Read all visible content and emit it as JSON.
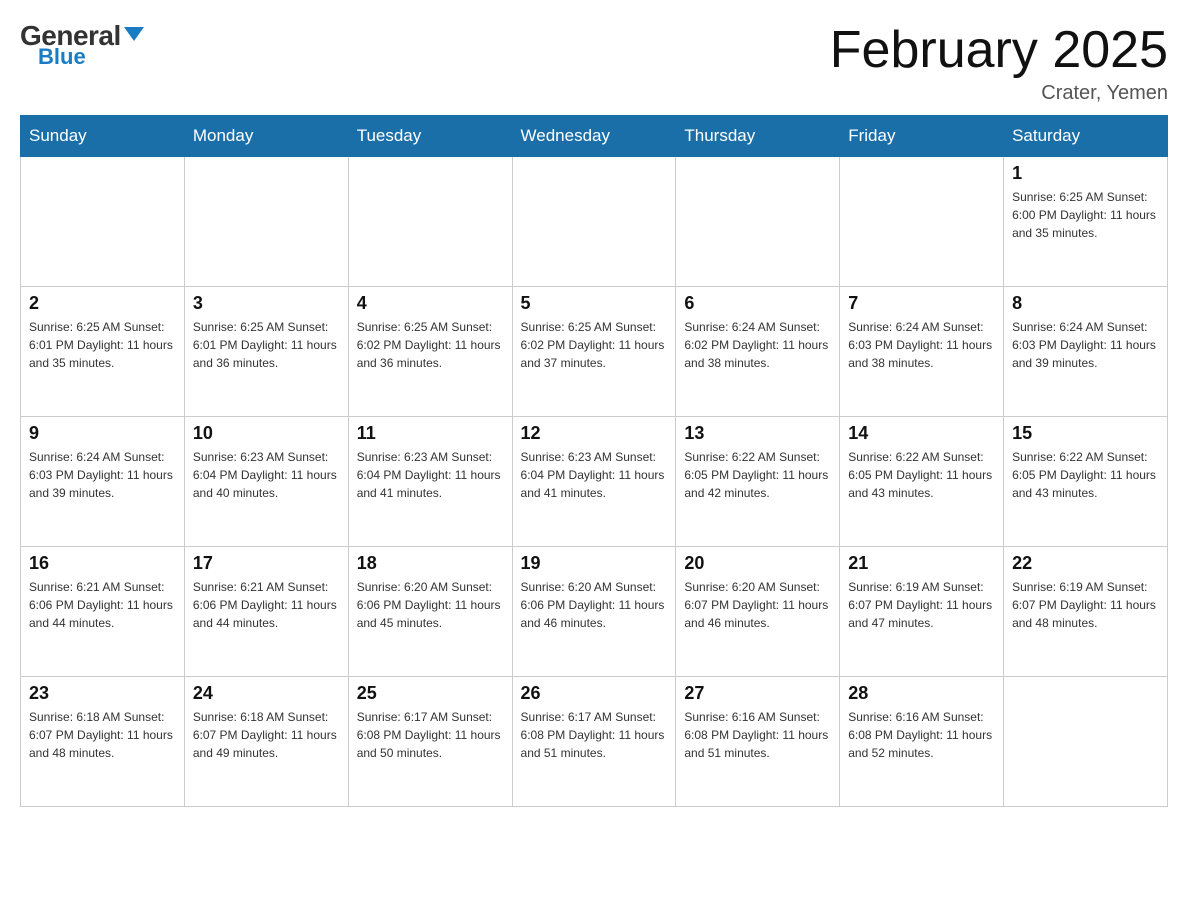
{
  "header": {
    "logo_general": "General",
    "logo_blue": "Blue",
    "month_title": "February 2025",
    "location": "Crater, Yemen"
  },
  "weekdays": [
    "Sunday",
    "Monday",
    "Tuesday",
    "Wednesday",
    "Thursday",
    "Friday",
    "Saturday"
  ],
  "weeks": [
    [
      {
        "day": "",
        "info": ""
      },
      {
        "day": "",
        "info": ""
      },
      {
        "day": "",
        "info": ""
      },
      {
        "day": "",
        "info": ""
      },
      {
        "day": "",
        "info": ""
      },
      {
        "day": "",
        "info": ""
      },
      {
        "day": "1",
        "info": "Sunrise: 6:25 AM\nSunset: 6:00 PM\nDaylight: 11 hours\nand 35 minutes."
      }
    ],
    [
      {
        "day": "2",
        "info": "Sunrise: 6:25 AM\nSunset: 6:01 PM\nDaylight: 11 hours\nand 35 minutes."
      },
      {
        "day": "3",
        "info": "Sunrise: 6:25 AM\nSunset: 6:01 PM\nDaylight: 11 hours\nand 36 minutes."
      },
      {
        "day": "4",
        "info": "Sunrise: 6:25 AM\nSunset: 6:02 PM\nDaylight: 11 hours\nand 36 minutes."
      },
      {
        "day": "5",
        "info": "Sunrise: 6:25 AM\nSunset: 6:02 PM\nDaylight: 11 hours\nand 37 minutes."
      },
      {
        "day": "6",
        "info": "Sunrise: 6:24 AM\nSunset: 6:02 PM\nDaylight: 11 hours\nand 38 minutes."
      },
      {
        "day": "7",
        "info": "Sunrise: 6:24 AM\nSunset: 6:03 PM\nDaylight: 11 hours\nand 38 minutes."
      },
      {
        "day": "8",
        "info": "Sunrise: 6:24 AM\nSunset: 6:03 PM\nDaylight: 11 hours\nand 39 minutes."
      }
    ],
    [
      {
        "day": "9",
        "info": "Sunrise: 6:24 AM\nSunset: 6:03 PM\nDaylight: 11 hours\nand 39 minutes."
      },
      {
        "day": "10",
        "info": "Sunrise: 6:23 AM\nSunset: 6:04 PM\nDaylight: 11 hours\nand 40 minutes."
      },
      {
        "day": "11",
        "info": "Sunrise: 6:23 AM\nSunset: 6:04 PM\nDaylight: 11 hours\nand 41 minutes."
      },
      {
        "day": "12",
        "info": "Sunrise: 6:23 AM\nSunset: 6:04 PM\nDaylight: 11 hours\nand 41 minutes."
      },
      {
        "day": "13",
        "info": "Sunrise: 6:22 AM\nSunset: 6:05 PM\nDaylight: 11 hours\nand 42 minutes."
      },
      {
        "day": "14",
        "info": "Sunrise: 6:22 AM\nSunset: 6:05 PM\nDaylight: 11 hours\nand 43 minutes."
      },
      {
        "day": "15",
        "info": "Sunrise: 6:22 AM\nSunset: 6:05 PM\nDaylight: 11 hours\nand 43 minutes."
      }
    ],
    [
      {
        "day": "16",
        "info": "Sunrise: 6:21 AM\nSunset: 6:06 PM\nDaylight: 11 hours\nand 44 minutes."
      },
      {
        "day": "17",
        "info": "Sunrise: 6:21 AM\nSunset: 6:06 PM\nDaylight: 11 hours\nand 44 minutes."
      },
      {
        "day": "18",
        "info": "Sunrise: 6:20 AM\nSunset: 6:06 PM\nDaylight: 11 hours\nand 45 minutes."
      },
      {
        "day": "19",
        "info": "Sunrise: 6:20 AM\nSunset: 6:06 PM\nDaylight: 11 hours\nand 46 minutes."
      },
      {
        "day": "20",
        "info": "Sunrise: 6:20 AM\nSunset: 6:07 PM\nDaylight: 11 hours\nand 46 minutes."
      },
      {
        "day": "21",
        "info": "Sunrise: 6:19 AM\nSunset: 6:07 PM\nDaylight: 11 hours\nand 47 minutes."
      },
      {
        "day": "22",
        "info": "Sunrise: 6:19 AM\nSunset: 6:07 PM\nDaylight: 11 hours\nand 48 minutes."
      }
    ],
    [
      {
        "day": "23",
        "info": "Sunrise: 6:18 AM\nSunset: 6:07 PM\nDaylight: 11 hours\nand 48 minutes."
      },
      {
        "day": "24",
        "info": "Sunrise: 6:18 AM\nSunset: 6:07 PM\nDaylight: 11 hours\nand 49 minutes."
      },
      {
        "day": "25",
        "info": "Sunrise: 6:17 AM\nSunset: 6:08 PM\nDaylight: 11 hours\nand 50 minutes."
      },
      {
        "day": "26",
        "info": "Sunrise: 6:17 AM\nSunset: 6:08 PM\nDaylight: 11 hours\nand 51 minutes."
      },
      {
        "day": "27",
        "info": "Sunrise: 6:16 AM\nSunset: 6:08 PM\nDaylight: 11 hours\nand 51 minutes."
      },
      {
        "day": "28",
        "info": "Sunrise: 6:16 AM\nSunset: 6:08 PM\nDaylight: 11 hours\nand 52 minutes."
      },
      {
        "day": "",
        "info": ""
      }
    ]
  ]
}
